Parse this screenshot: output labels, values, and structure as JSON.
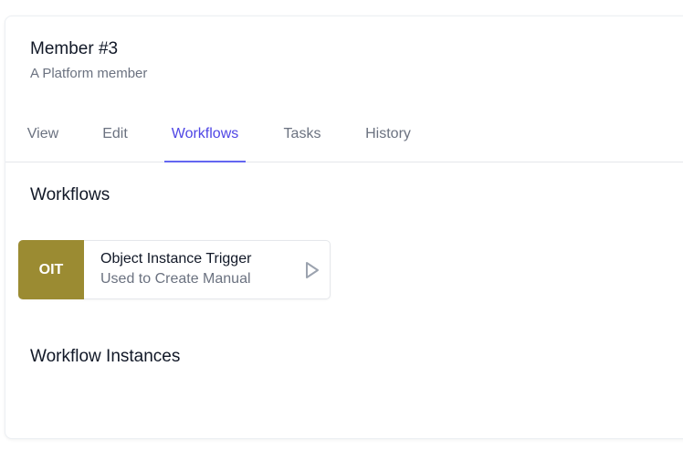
{
  "member": {
    "title": "Member #3",
    "subtitle": "A Platform member"
  },
  "tabs": [
    {
      "label": "View",
      "active": false
    },
    {
      "label": "Edit",
      "active": false
    },
    {
      "label": "Workflows",
      "active": true
    },
    {
      "label": "Tasks",
      "active": false
    },
    {
      "label": "History",
      "active": false
    }
  ],
  "workflows_section": {
    "title": "Workflows",
    "items": [
      {
        "badge": "OIT",
        "badge_color": "#9b8b32",
        "name": "Object Instance Trigger",
        "description": "Used to Create Manual",
        "action_icon": "play-icon"
      }
    ]
  },
  "instances_section": {
    "title": "Workflow Instances"
  },
  "colors": {
    "accent": "#4f46e5",
    "badge": "#9b8b32"
  }
}
